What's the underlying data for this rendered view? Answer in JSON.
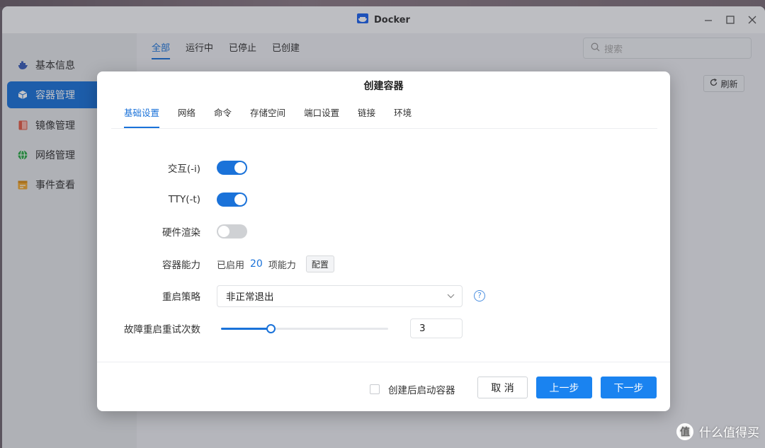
{
  "window": {
    "title": "Docker",
    "controls": [
      "minimize",
      "maximize",
      "close"
    ]
  },
  "sidebar": {
    "items": [
      {
        "label": "基本信息",
        "icon": "docker-whale-icon",
        "active": false
      },
      {
        "label": "容器管理",
        "icon": "cube-icon",
        "active": true
      },
      {
        "label": "镜像管理",
        "icon": "image-icon",
        "active": false
      },
      {
        "label": "网络管理",
        "icon": "globe-icon",
        "active": false
      },
      {
        "label": "事件查看",
        "icon": "calendar-icon",
        "active": false
      }
    ]
  },
  "main": {
    "tabs": [
      "全部",
      "运行中",
      "已停止",
      "已创建"
    ],
    "active_tab": "全部",
    "search_placeholder": "搜索",
    "refresh_label": "刷新"
  },
  "dialog": {
    "title": "创建容器",
    "tabs": [
      "基础设置",
      "网络",
      "命令",
      "存储空间",
      "端口设置",
      "链接",
      "环境"
    ],
    "active_tab": "基础设置",
    "fields": {
      "interactive": {
        "label": "交互(-i)",
        "on": true
      },
      "tty": {
        "label": "TTY(-t)",
        "on": true
      },
      "hardware_render": {
        "label": "硬件渲染",
        "on": false
      },
      "capabilities": {
        "label": "容器能力",
        "prefix": "已启用",
        "count": "20",
        "suffix": "项能力",
        "button": "配置"
      },
      "restart_policy": {
        "label": "重启策略",
        "value": "非正常退出"
      },
      "retry_count": {
        "label": "故障重启重试次数",
        "value": "3",
        "slider_fraction": 0.3
      }
    },
    "footer": {
      "start_after_create": "创建后启动容器",
      "start_after_create_checked": false,
      "cancel": "取 消",
      "prev": "上一步",
      "next": "下一步"
    }
  },
  "colors": {
    "accent": "#1a72d9",
    "button_primary": "#1a83f0"
  },
  "watermark": {
    "text": "什么值得买",
    "logo_text": "值"
  }
}
